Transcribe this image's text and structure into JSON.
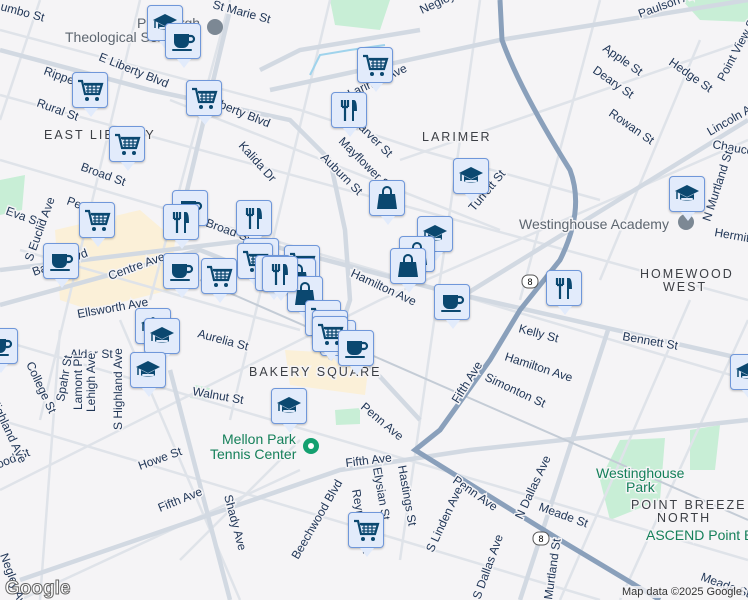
{
  "map": {
    "labels": [
      "umbo St",
      "St Marie St",
      "Pittsburgh",
      "Theological Seminary",
      "E Liberty Blvd",
      "Liberty Blvd",
      "Rippey St",
      "Rural St",
      "Broad St",
      "Kalida Dr",
      "Negley Ave",
      "Larimer Ave",
      "Carver St",
      "Mayflower St",
      "Auburn St",
      "Turrett St",
      "Paulson Ave",
      "Apple St",
      "Deary St",
      "Hedge St",
      "Point View St",
      "Rowan St",
      "Lincoln Ave",
      "Chaucer St",
      "N Murtland St",
      "Hermitage St",
      "Eva St",
      "S Euclid Ave",
      "Penn Ave",
      "Baum Blvd",
      "Centre Ave",
      "Broad St",
      "Ellsworth Ave",
      "Hamilton Ave",
      "Hamilton Ave",
      "Kelly St",
      "Bennett St",
      "Aurelia St",
      "Alder St",
      "College St",
      "Spahr St",
      "Lamont Pl",
      "Lehigh Ave",
      "S Highland Ave",
      "Walnut St",
      "Simonton St",
      "Fifth Ave",
      "Penn Ave",
      "Howe St",
      "Fifth Ave",
      "Fifth Ave",
      "Shady Ave",
      "Beechwood Blvd",
      "Elysian St",
      "Hastings St",
      "Penn Ave",
      "N Dallas Ave",
      "Meade St",
      "S Linden Ave",
      "S Dallas Ave",
      "Murtland St",
      "Reynolds St",
      "Meade St",
      "Negley Ave",
      "Oakwood St",
      "Highland Ave"
    ],
    "neighborhoods": [
      "EAST LIBERTY",
      "LARIMER",
      "HOMEWOOD",
      "WEST",
      "BAKERY SQUARE",
      "POINT BREEZE",
      "NORTH"
    ],
    "pois": {
      "academy": "Westinghouse Academy",
      "mellon_1": "Mellon Park",
      "mellon_2": "Tennis Center",
      "park_1": "Westinghouse",
      "park_2": "Park",
      "ascend": "ASCEND Point Breeze"
    },
    "route_shield": "8",
    "markers": [
      "grad",
      "coffee",
      "cart",
      "cart",
      "cart",
      "food",
      "cart",
      "bag",
      "grad",
      "grad",
      "coffee",
      "food",
      "cart",
      "food",
      "food",
      "coffee",
      "grad",
      "bag",
      "bag",
      "cart",
      "cart",
      "food",
      "bag",
      "bag",
      "coffee",
      "cart",
      "coffee",
      "food",
      "grad",
      "grad",
      "grad",
      "coffee",
      "cart",
      "cart",
      "food",
      "coffee",
      "coffee",
      "grad",
      "cart",
      "grad"
    ],
    "attribution": "Map data ©2025 Google",
    "logo": "Google"
  },
  "colors": {
    "marker_bg": "#e2ebfb",
    "marker_border": "#6f97da",
    "icon": "#0b4870",
    "highway": "#8aa0bb",
    "road": "#d6dce4",
    "park": "#c8f0d6"
  }
}
